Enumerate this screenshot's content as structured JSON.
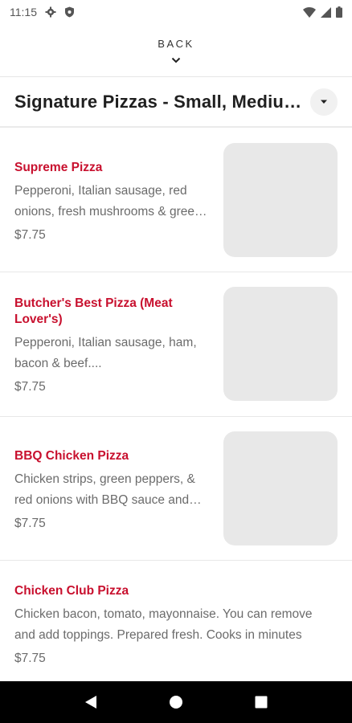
{
  "status_bar": {
    "time": "11:15",
    "icons": [
      "gear-icon",
      "shield-icon",
      "wifi-icon",
      "signal-icon",
      "battery-icon"
    ]
  },
  "header": {
    "back_label": "BACK"
  },
  "category": {
    "title": "Signature Pizzas - Small, Medium, Large"
  },
  "menu_items": [
    {
      "name": "Supreme Pizza",
      "description": "Pepperoni, Italian sausage, red onions, fresh mushrooms & green peppers",
      "price": "$7.75",
      "has_image": true
    },
    {
      "name": "Butcher's Best Pizza (Meat Lover's)",
      "description": "Pepperoni, Italian sausage, ham, bacon & beef....",
      "price": "$7.75",
      "has_image": true
    },
    {
      "name": "BBQ Chicken Pizza",
      "description": "Chicken strips, green peppers, & red onions with BBQ sauce and mozzarella",
      "price": "$7.75",
      "has_image": true
    },
    {
      "name": "Chicken Club Pizza",
      "description": "Chicken bacon, tomato, mayonnaise. You can remove and add toppings. Prepared fresh. Cooks in minutes",
      "price": "$7.75",
      "has_image": false
    }
  ],
  "colors": {
    "accent": "#c8102e",
    "text_secondary": "#6b6b6b",
    "image_placeholder": "#e8e8e8"
  }
}
